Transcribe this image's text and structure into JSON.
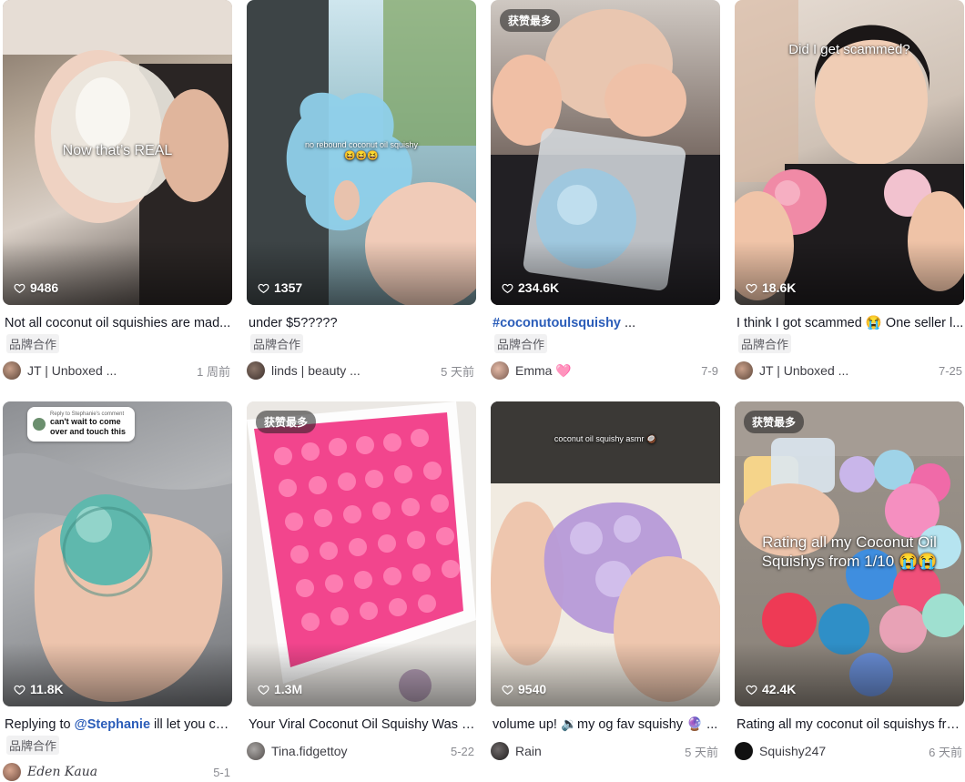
{
  "likes_icon": "heart-outline-icon",
  "cards": [
    {
      "likes": "9486",
      "overlay": "Now that’s REAL",
      "desc": "Not all coconut oil squishies are mad...",
      "chip": "品牌合作",
      "author": "JT | Unboxed ...",
      "date": "1 周前"
    },
    {
      "likes": "1357",
      "overlay": "no rebound coconut oil squishy",
      "overlay_emoji": "😆😆😆",
      "desc": "under $5?????",
      "chip": "品牌合作",
      "author": "linds | beauty ...",
      "date": "5 天前"
    },
    {
      "badge": "获赞最多",
      "likes": "234.6K",
      "desc_tag": "#coconutoulsquishy",
      "desc_rest": " ...",
      "chip": "品牌合作",
      "author": "Emma",
      "author_emoji": "🩷",
      "date": "7-9"
    },
    {
      "likes": "18.6K",
      "overlay": "Did I get scammed?",
      "desc": "I think I got scammed 😭  One seller l...",
      "chip": "品牌合作",
      "author": "JT | Unboxed ...",
      "date": "7-25"
    },
    {
      "likes": "11.8K",
      "reply_title": "Reply to Stephanie's comment",
      "reply_body": "can't wait to come over and touch this",
      "desc_pre": "Replying to ",
      "desc_mention": "@Stephanie",
      "desc_post": " ill let you co...",
      "chip": "品牌合作",
      "author": "Eden Kaua",
      "date": "5-1"
    },
    {
      "badge": "获赞最多",
      "likes": "1.3M",
      "desc": "Your Viral Coconut Oil Squishy Was P...",
      "author": "Tina.fidgettoy",
      "date": "5-22"
    },
    {
      "likes": "9540",
      "overlay": "coconut oil squishy asmr 🥥",
      "desc": "volume up! 🔉my og fav squishy 🔮 ...",
      "author": "Rain",
      "date": "5 天前"
    },
    {
      "badge": "获赞最多",
      "likes": "42.4K",
      "overlay": "Rating all my Coconut Oil Squishys from 1/10 😭😭",
      "desc": "Rating all my coconut oil squishys fro...",
      "author": "Squishy247",
      "date": "6 天前"
    }
  ]
}
